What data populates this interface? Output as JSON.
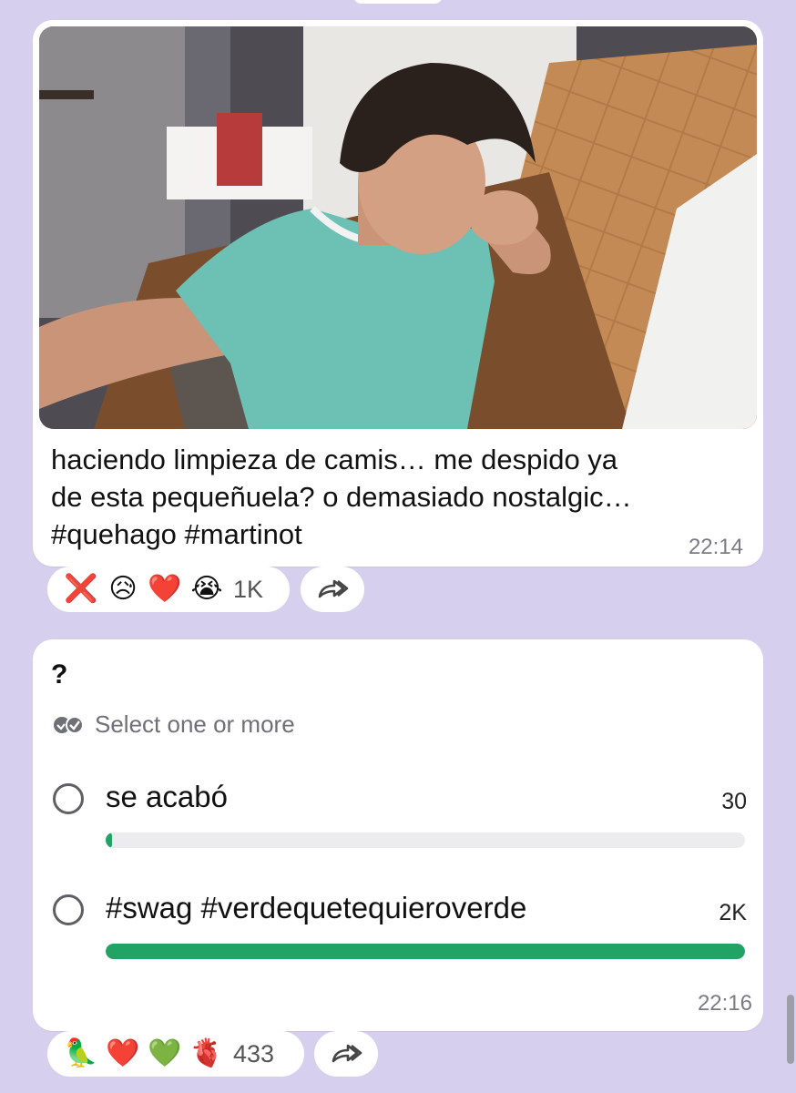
{
  "post": {
    "image_alt": "selfie photo",
    "caption_lines": [
      "haciendo limpieza de camis… me despido ya",
      "de esta pequeñuela? o demasiado nostalgic…",
      "#quehago #martinot"
    ],
    "time": "22:14",
    "reactions": {
      "emojis": [
        "❌",
        "😥",
        "❤️",
        "😭"
      ],
      "count": "1K"
    }
  },
  "poll": {
    "question": "?",
    "mode_label": "Select one or more",
    "options": [
      {
        "label": "se acabó",
        "votes": "30",
        "share": 0.01
      },
      {
        "label": "#swag #verdequetequieroverde",
        "votes": "2K",
        "share": 1.0
      }
    ],
    "time": "22:16",
    "reactions": {
      "emojis": [
        "🦜",
        "❤️",
        "💚",
        "🫀"
      ],
      "count": "433"
    }
  },
  "colors": {
    "background": "#d6cfee",
    "bubble": "#ffffff",
    "bar_fill": "#21a366",
    "bar_track": "#ececee"
  }
}
